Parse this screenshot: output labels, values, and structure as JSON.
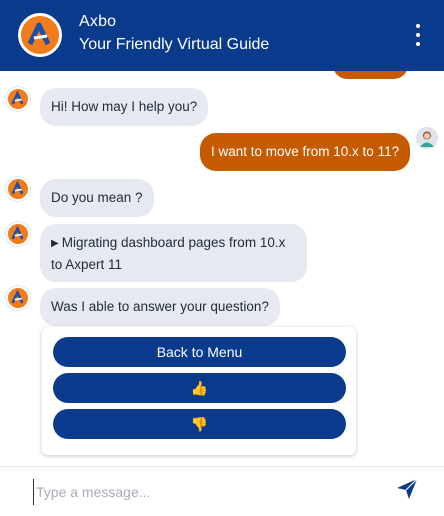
{
  "header": {
    "title": "Axbo",
    "subtitle": "Your Friendly Virtual Guide",
    "menu_icon": "kebab-menu-icon"
  },
  "messages": [
    {
      "from": "bot",
      "text": "Hi! How may I help you?"
    },
    {
      "from": "user",
      "text": "I want to move from 10.x to 11?"
    },
    {
      "from": "bot",
      "text": "Do you mean ?"
    },
    {
      "from": "bot",
      "text": "Migrating dashboard pages from 10.x to Axpert 11"
    },
    {
      "from": "bot",
      "text": "Was I able to answer your question?"
    }
  ],
  "options": {
    "back_label": "Back to Menu",
    "thumbs_up": "👍",
    "thumbs_down": "👎"
  },
  "composer": {
    "placeholder": "Type a message..."
  },
  "colors": {
    "header": "#0a3a8c",
    "user_bubble": "#c65a00",
    "bot_bubble": "#e6e9ef",
    "avatar": "#f07c1b"
  }
}
